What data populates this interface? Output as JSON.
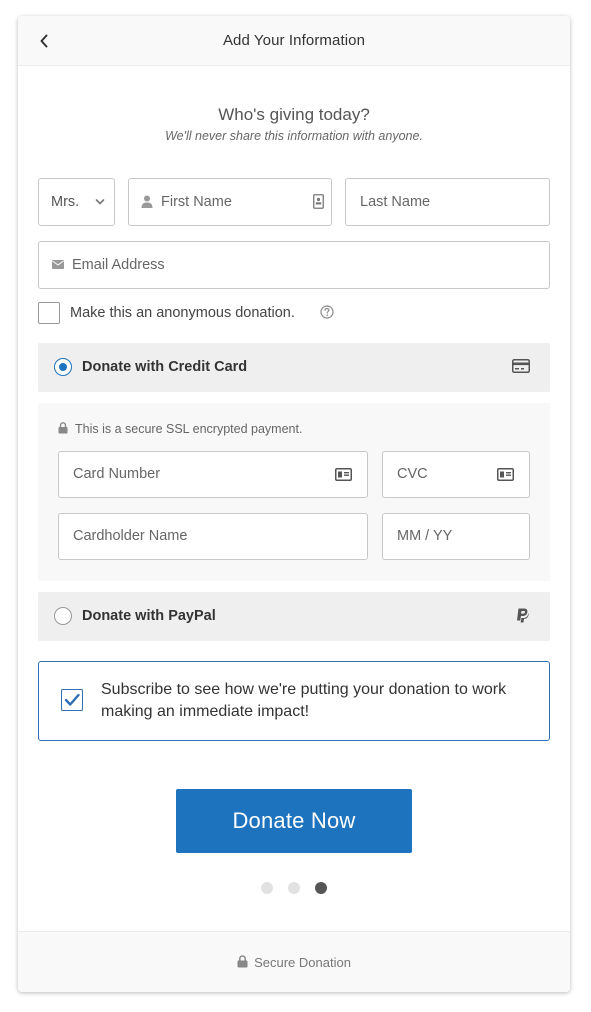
{
  "header": {
    "title": "Add Your Information",
    "back_icon": "chevron-left-icon"
  },
  "intro": {
    "title": "Who's giving today?",
    "subtitle": "We'll never share this information with anyone."
  },
  "form": {
    "salutation": {
      "value": "Mrs.",
      "icon": "chevron-down-icon"
    },
    "first_name": {
      "placeholder": "First Name",
      "icon": "person-icon",
      "trail_icon": "contact-card-icon"
    },
    "last_name": {
      "placeholder": "Last Name"
    },
    "email": {
      "placeholder": "Email Address",
      "icon": "envelope-icon"
    },
    "anonymous": {
      "label": "Make this an anonymous donation.",
      "checked": false,
      "icon": "help-icon"
    }
  },
  "payment": {
    "credit_card": {
      "label": "Donate with Credit Card",
      "selected": true,
      "icon": "credit-card-icon",
      "ssl_note": "This is a secure SSL encrypted payment.",
      "card_number": {
        "placeholder": "Card Number",
        "icon": "card-id-icon"
      },
      "cvc": {
        "placeholder": "CVC",
        "icon": "card-id-icon"
      },
      "cardholder": {
        "placeholder": "Cardholder Name"
      },
      "expiry": {
        "placeholder": "MM / YY"
      }
    },
    "paypal": {
      "label": "Donate with PayPal",
      "selected": false,
      "icon": "paypal-icon"
    }
  },
  "subscribe": {
    "text": "Subscribe to see how we're putting your donation to work making an immediate impact!",
    "checked": true
  },
  "donate_button": "Donate Now",
  "steps": {
    "count": 3,
    "active": 3
  },
  "footer": {
    "text": "Secure Donation",
    "icon": "lock-icon"
  },
  "colors": {
    "accent": "#1e73be",
    "panel": "#efefef",
    "border": "#c8c8c8"
  }
}
